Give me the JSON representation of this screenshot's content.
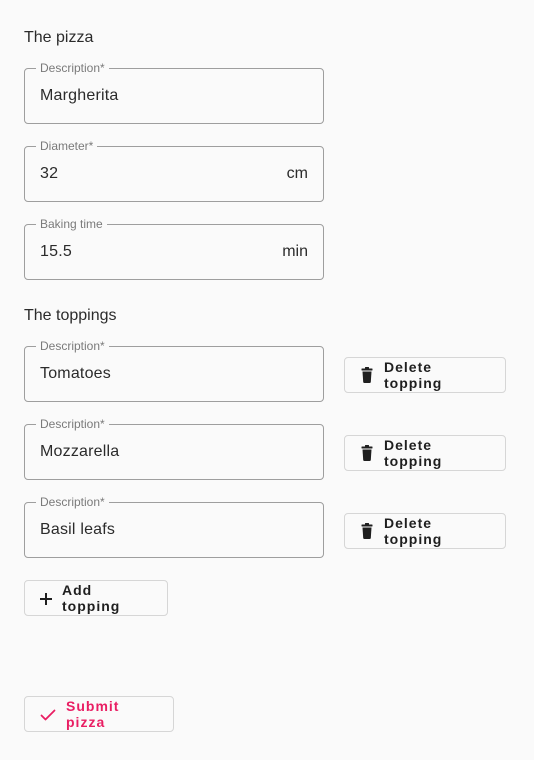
{
  "pizza_section": {
    "title": "The pizza",
    "description": {
      "label": "Description*",
      "value": "Margherita"
    },
    "diameter": {
      "label": "Diameter*",
      "value": "32",
      "suffix": "cm"
    },
    "baking_time": {
      "label": "Baking time",
      "value": "15.5",
      "suffix": "min"
    }
  },
  "toppings_section": {
    "title": "The toppings",
    "items": [
      {
        "label": "Description*",
        "value": "Tomatoes",
        "delete_label": "Delete topping"
      },
      {
        "label": "Description*",
        "value": "Mozzarella",
        "delete_label": "Delete topping"
      },
      {
        "label": "Description*",
        "value": "Basil leafs",
        "delete_label": "Delete topping"
      }
    ],
    "add_label": "Add topping"
  },
  "submit": {
    "label": "Submit pizza",
    "color": "#e91e63"
  },
  "icons": {
    "delete": "trash-icon",
    "add": "plus-icon",
    "submit": "check-icon"
  }
}
